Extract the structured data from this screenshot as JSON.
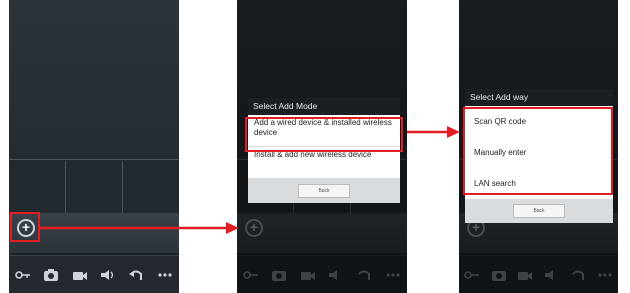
{
  "screens": {
    "screen1": {
      "add_button_glyph": "+",
      "toolbar": [
        {
          "name": "key-icon"
        },
        {
          "name": "camera-icon"
        },
        {
          "name": "video-icon"
        },
        {
          "name": "speaker-icon"
        },
        {
          "name": "undo-icon"
        },
        {
          "name": "more-icon"
        }
      ]
    },
    "screen2": {
      "dialog_title": "Select Add Mode",
      "options": [
        "Add a wired device & installed wireless device",
        "Install & add new wireless device"
      ],
      "button_label": "Back"
    },
    "screen3": {
      "dialog_title": "Select Add way",
      "options": [
        "Scan QR code",
        "Manually enter",
        "LAN search"
      ],
      "button_label": "Back"
    }
  },
  "colors": {
    "highlight": "#e01e24",
    "phone_bg": "#1f262c",
    "dialog_title_bg": "#1a1f23"
  }
}
